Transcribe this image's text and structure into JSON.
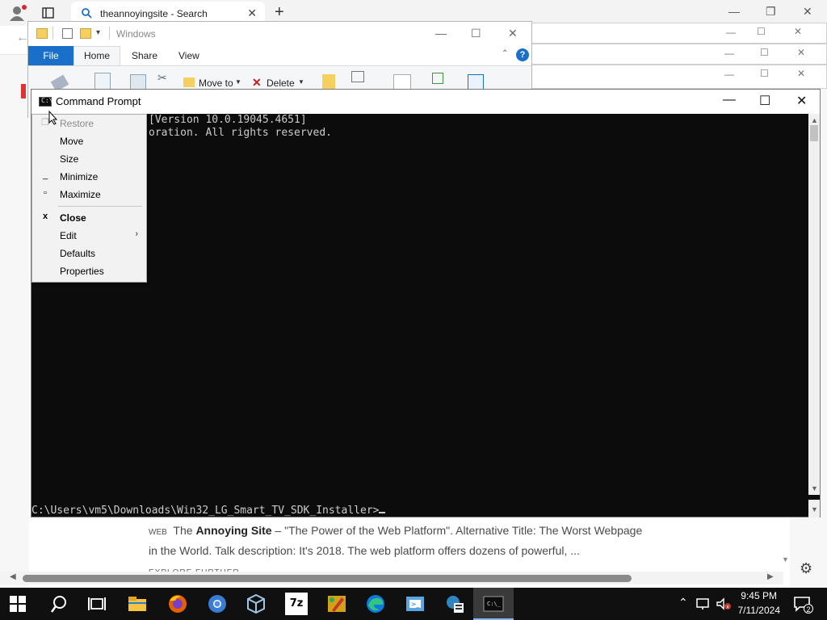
{
  "browser": {
    "tab_title": "theannoyingsite - Search",
    "result": {
      "tag": "WEB",
      "title_prefix": "The ",
      "title_bold": "Annoying Site",
      "snippet_1": " – \"The Power of the Web Platform\". Alternative Title: The Worst Webpage",
      "snippet_2": "in the World. Talk description: It's 2018. The web platform offers dozens of powerful, ..."
    },
    "explore_label": "EXPLORE FURTHER"
  },
  "explorer": {
    "title": "Windows",
    "tabs": {
      "file": "File",
      "home": "Home",
      "share": "Share",
      "view": "View"
    },
    "ribbon": {
      "move_to": "Move to",
      "delete": "Delete"
    }
  },
  "cmd": {
    "title": "Command Prompt",
    "line_1": "[Version 10.0.19045.4651]",
    "line_2": "oration. All rights reserved.",
    "prompt": "C:\\Users\\vm5\\Downloads\\Win32_LG_Smart_TV_SDK_Installer>"
  },
  "system_menu": {
    "items": [
      {
        "label": "Restore",
        "glyph": "",
        "disabled": true
      },
      {
        "label": "Move",
        "glyph": ""
      },
      {
        "label": "Size",
        "glyph": ""
      },
      {
        "label": "Minimize",
        "glyph": "_"
      },
      {
        "label": "Maximize",
        "glyph": "▫"
      },
      {
        "label": "Close",
        "glyph": "x",
        "bold": true
      },
      {
        "label": "Edit",
        "glyph": "",
        "submenu": true
      },
      {
        "label": "Defaults",
        "glyph": ""
      },
      {
        "label": "Properties",
        "glyph": ""
      }
    ]
  },
  "taskbar": {
    "time": "9:45 PM",
    "date": "7/11/2024",
    "notification_count": "2",
    "accent": "#8ab4f8"
  }
}
